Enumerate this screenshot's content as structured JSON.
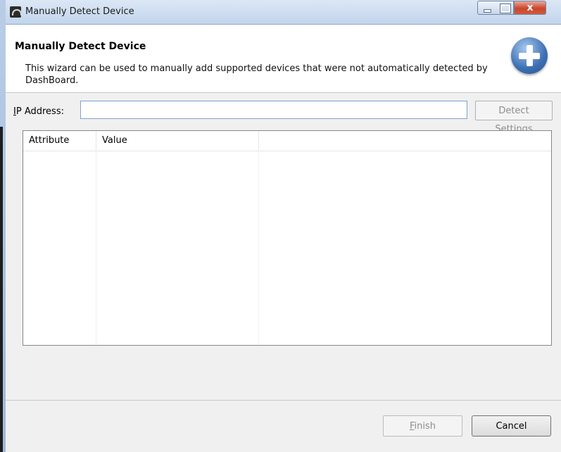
{
  "window": {
    "title": "Manually Detect Device",
    "icon": "dashboard-app-icon",
    "controls": {
      "minimize": "minimize",
      "maximize": "maximize",
      "close": "x"
    }
  },
  "header": {
    "title": "Manually Detect Device",
    "description": "This wizard can be used to manually add supported devices that were not automatically detected by DashBoard.",
    "badge_icon": "add-plus-icon"
  },
  "form": {
    "ip_label_mnemonic": "I",
    "ip_label_rest": "P Address:",
    "ip_value": "",
    "detect_button": "Detect Settings"
  },
  "table": {
    "columns": [
      "Attribute",
      "Value",
      ""
    ],
    "rows": []
  },
  "footer": {
    "finish_mnemonic": "F",
    "finish_rest": "inish",
    "cancel": "Cancel"
  }
}
